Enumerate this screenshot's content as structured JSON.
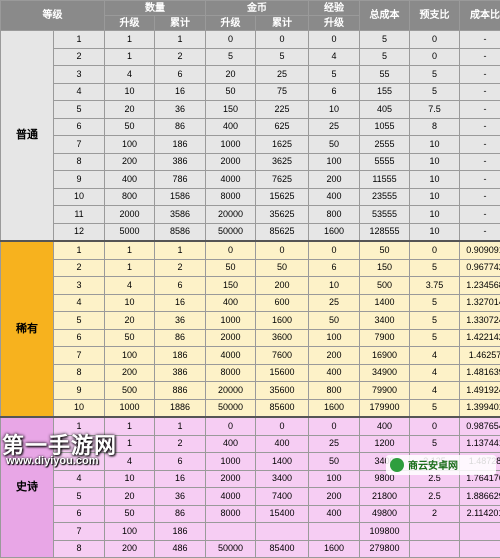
{
  "header": {
    "level": "等级",
    "quantity": "数量",
    "gold": "金币",
    "exp": "经验",
    "total_cost": "总成本",
    "expected_ratio": "预支比",
    "cost_ratio": "成本比",
    "upgrade": "升级",
    "cumulative": "累计",
    "upgrade_exp": "升级"
  },
  "tiers": [
    {
      "name": "普通",
      "color": "#e6e6e6",
      "rows": [
        [
          "1",
          "1",
          "1",
          "0",
          "0",
          "0",
          "5",
          "0",
          "-"
        ],
        [
          "2",
          "1",
          "2",
          "5",
          "5",
          "4",
          "5",
          "0",
          "-"
        ],
        [
          "3",
          "4",
          "6",
          "20",
          "25",
          "5",
          "55",
          "5",
          "-"
        ],
        [
          "4",
          "10",
          "16",
          "50",
          "75",
          "6",
          "155",
          "5",
          "-"
        ],
        [
          "5",
          "20",
          "36",
          "150",
          "225",
          "10",
          "405",
          "7.5",
          "-"
        ],
        [
          "6",
          "50",
          "86",
          "400",
          "625",
          "25",
          "1055",
          "8",
          "-"
        ],
        [
          "7",
          "100",
          "186",
          "1000",
          "1625",
          "50",
          "2555",
          "10",
          "-"
        ],
        [
          "8",
          "200",
          "386",
          "2000",
          "3625",
          "100",
          "5555",
          "10",
          "-"
        ],
        [
          "9",
          "400",
          "786",
          "4000",
          "7625",
          "200",
          "11555",
          "10",
          "-"
        ],
        [
          "10",
          "800",
          "1586",
          "8000",
          "15625",
          "400",
          "23555",
          "10",
          "-"
        ],
        [
          "11",
          "2000",
          "3586",
          "20000",
          "35625",
          "800",
          "53555",
          "10",
          "-"
        ],
        [
          "12",
          "5000",
          "8586",
          "50000",
          "85625",
          "1600",
          "128555",
          "10",
          "-"
        ]
      ]
    },
    {
      "name": "稀有",
      "color": "#fdf2c8",
      "tiercolor": "#f7b21e",
      "rows": [
        [
          "1",
          "1",
          "1",
          "0",
          "0",
          "0",
          "50",
          "0",
          "0.909091"
        ],
        [
          "2",
          "1",
          "2",
          "50",
          "50",
          "6",
          "150",
          "5",
          "0.967742"
        ],
        [
          "3",
          "4",
          "6",
          "150",
          "200",
          "10",
          "500",
          "3.75",
          "1.234568"
        ],
        [
          "4",
          "10",
          "16",
          "400",
          "600",
          "25",
          "1400",
          "5",
          "1.327014"
        ],
        [
          "5",
          "20",
          "36",
          "1000",
          "1600",
          "50",
          "3400",
          "5",
          "1.330724"
        ],
        [
          "6",
          "50",
          "86",
          "2000",
          "3600",
          "100",
          "7900",
          "5",
          "1.422142"
        ],
        [
          "7",
          "100",
          "186",
          "4000",
          "7600",
          "200",
          "16900",
          "4",
          "1.46257"
        ],
        [
          "8",
          "200",
          "386",
          "8000",
          "15600",
          "400",
          "34900",
          "4",
          "1.481639"
        ],
        [
          "9",
          "500",
          "886",
          "20000",
          "35600",
          "800",
          "79900",
          "4",
          "1.491924"
        ],
        [
          "10",
          "1000",
          "1886",
          "50000",
          "85600",
          "1600",
          "179900",
          "5",
          "1.399401"
        ]
      ]
    },
    {
      "name": "史诗",
      "color": "#f6cdf3",
      "tiercolor": "#e8a6e6",
      "rows": [
        [
          "1",
          "1",
          "1",
          "0",
          "0",
          "0",
          "400",
          "0",
          "0.987654"
        ],
        [
          "2",
          "1",
          "2",
          "400",
          "400",
          "25",
          "1200",
          "5",
          "1.137441"
        ],
        [
          "3",
          "4",
          "6",
          "1000",
          "1400",
          "50",
          "3400",
          "3.125",
          "1.48728"
        ],
        [
          "4",
          "10",
          "16",
          "2000",
          "3400",
          "100",
          "9800",
          "2.5",
          "1.764176"
        ],
        [
          "5",
          "20",
          "36",
          "4000",
          "7400",
          "200",
          "21800",
          "2.5",
          "1.886629"
        ],
        [
          "6",
          "50",
          "86",
          "8000",
          "15400",
          "400",
          "49800",
          "2",
          "2.114201"
        ],
        [
          "7",
          "100",
          "186",
          "",
          "",
          "",
          "109800",
          "",
          ""
        ],
        [
          "8",
          "200",
          "486",
          "50000",
          "85400",
          "1600",
          "279800",
          "",
          ""
        ]
      ]
    }
  ],
  "watermark": {
    "title": "第一手游网",
    "url": "www.diyiyou.com",
    "badge": "商云安卓网"
  }
}
